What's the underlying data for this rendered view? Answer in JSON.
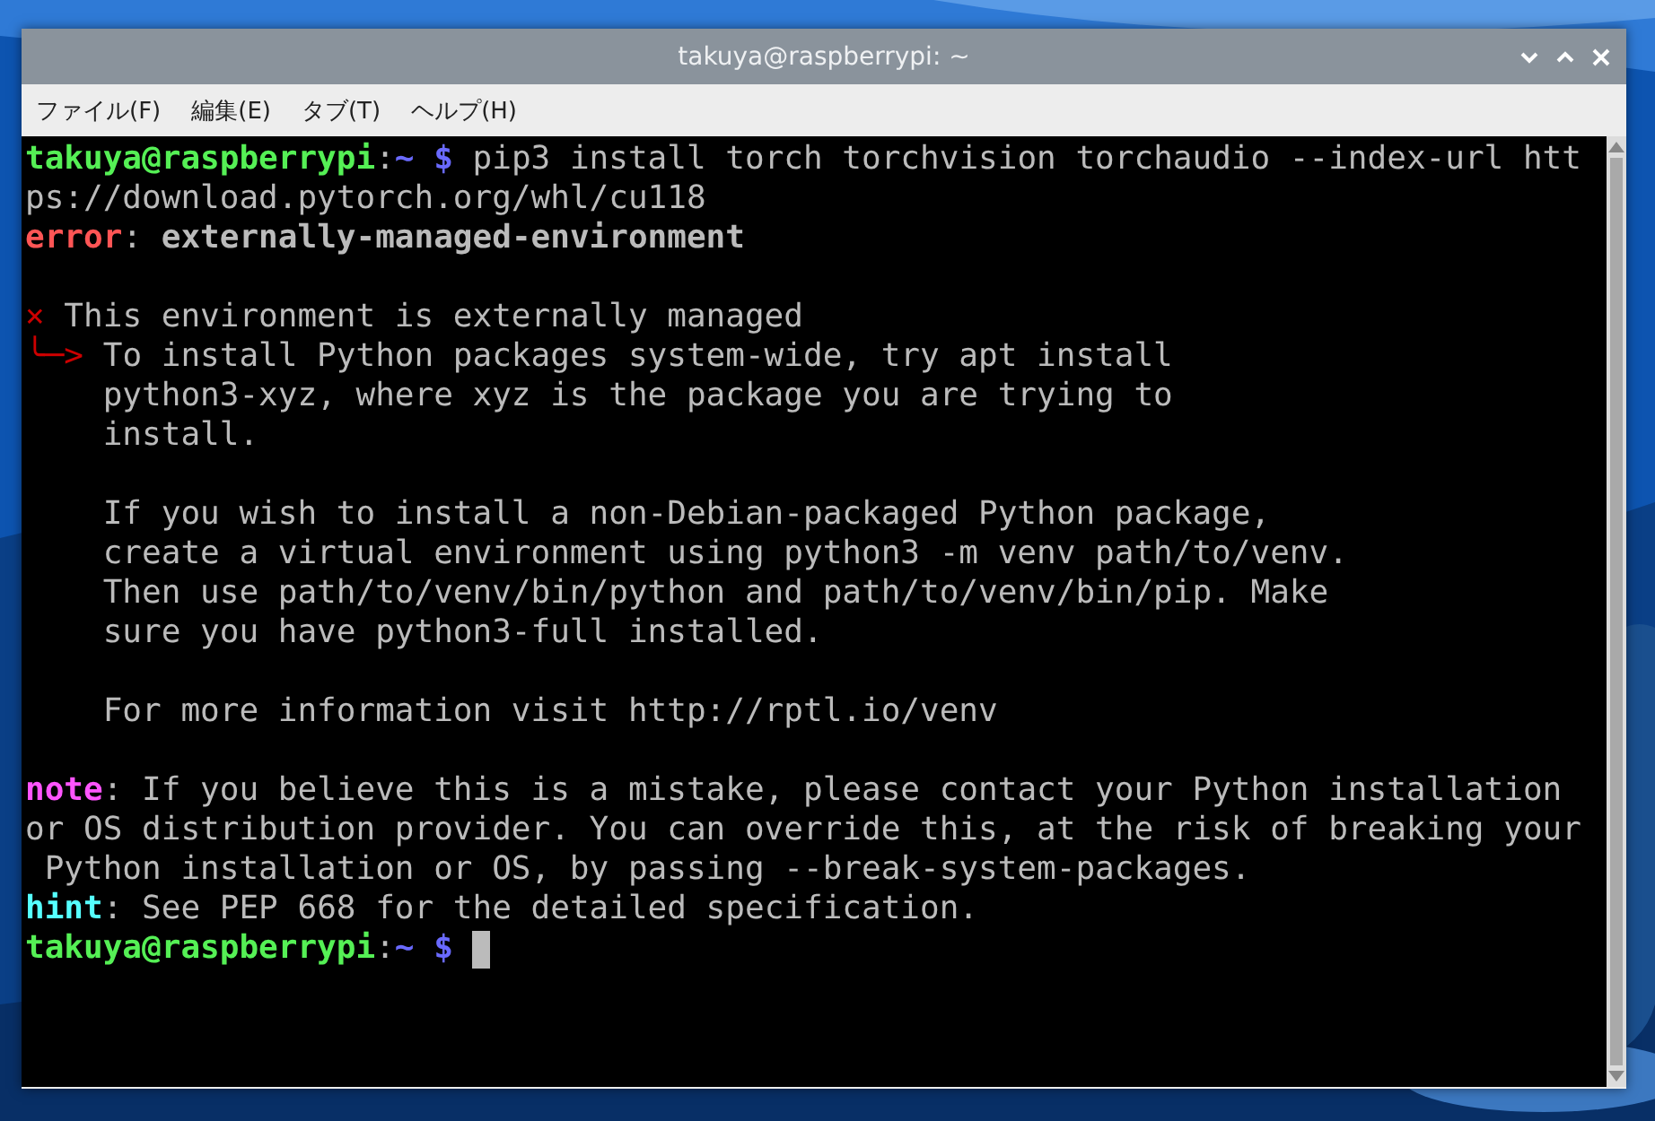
{
  "window": {
    "title": "takuya@raspberrypi: ~"
  },
  "menu": [
    {
      "label": "ファイル(F)"
    },
    {
      "label": "編集(E)"
    },
    {
      "label": "タブ(T)"
    },
    {
      "label": "ヘルプ(H)"
    }
  ],
  "terminal": {
    "lines": [
      {
        "kind": "text",
        "segments": [
          {
            "text": "takuya@raspberrypi",
            "kind": "user"
          },
          {
            "text": ":",
            "kind": "plain"
          },
          {
            "text": "~ $",
            "kind": "path"
          },
          {
            "text": " pip3 install torch torchvision torchaudio --index-url htt",
            "kind": "plain"
          }
        ]
      },
      {
        "kind": "text",
        "segments": [
          {
            "text": "ps://download.pytorch.org/whl/cu118",
            "kind": "plain"
          }
        ]
      },
      {
        "kind": "text",
        "segments": [
          {
            "text": "error",
            "kind": "error"
          },
          {
            "text": ": ",
            "kind": "plain"
          },
          {
            "text": "externally-managed-environment",
            "kind": "bold"
          }
        ]
      },
      {
        "kind": "blank"
      },
      {
        "kind": "text",
        "segments": [
          {
            "text": "×",
            "kind": "mark"
          },
          {
            "text": " This environment is externally managed",
            "kind": "plain"
          }
        ]
      },
      {
        "kind": "text",
        "segments": [
          {
            "text": "╰─>",
            "kind": "mark"
          },
          {
            "text": " To install Python packages system-wide, try apt install",
            "kind": "plain"
          }
        ]
      },
      {
        "kind": "text",
        "segments": [
          {
            "text": "    python3-xyz, where xyz is the package you are trying to",
            "kind": "plain"
          }
        ]
      },
      {
        "kind": "text",
        "segments": [
          {
            "text": "    install.",
            "kind": "plain"
          }
        ]
      },
      {
        "kind": "blank"
      },
      {
        "kind": "text",
        "segments": [
          {
            "text": "    If you wish to install a non-Debian-packaged Python package,",
            "kind": "plain"
          }
        ]
      },
      {
        "kind": "text",
        "segments": [
          {
            "text": "    create a virtual environment using python3 -m venv path/to/venv.",
            "kind": "plain"
          }
        ]
      },
      {
        "kind": "text",
        "segments": [
          {
            "text": "    Then use path/to/venv/bin/python and path/to/venv/bin/pip. Make",
            "kind": "plain"
          }
        ]
      },
      {
        "kind": "text",
        "segments": [
          {
            "text": "    sure you have python3-full installed.",
            "kind": "plain"
          }
        ]
      },
      {
        "kind": "blank"
      },
      {
        "kind": "text",
        "segments": [
          {
            "text": "    For more information visit http://rptl.io/venv",
            "kind": "plain"
          }
        ]
      },
      {
        "kind": "blank"
      },
      {
        "kind": "text",
        "segments": [
          {
            "text": "note",
            "kind": "note"
          },
          {
            "text": ": If you believe this is a mistake, please contact your Python installation",
            "kind": "plain"
          }
        ]
      },
      {
        "kind": "text",
        "segments": [
          {
            "text": "or OS distribution provider. You can override this, at the risk of breaking your",
            "kind": "plain"
          }
        ]
      },
      {
        "kind": "text",
        "segments": [
          {
            "text": " Python installation or OS, by passing --break-system-packages.",
            "kind": "plain"
          }
        ]
      },
      {
        "kind": "text",
        "segments": [
          {
            "text": "hint",
            "kind": "hint"
          },
          {
            "text": ": See PEP 668 for the detailed specification.",
            "kind": "plain"
          }
        ]
      },
      {
        "kind": "text",
        "cursor": true,
        "segments": [
          {
            "text": "takuya@raspberrypi",
            "kind": "user"
          },
          {
            "text": ":",
            "kind": "plain"
          },
          {
            "text": "~ $",
            "kind": "path"
          }
        ]
      }
    ]
  }
}
